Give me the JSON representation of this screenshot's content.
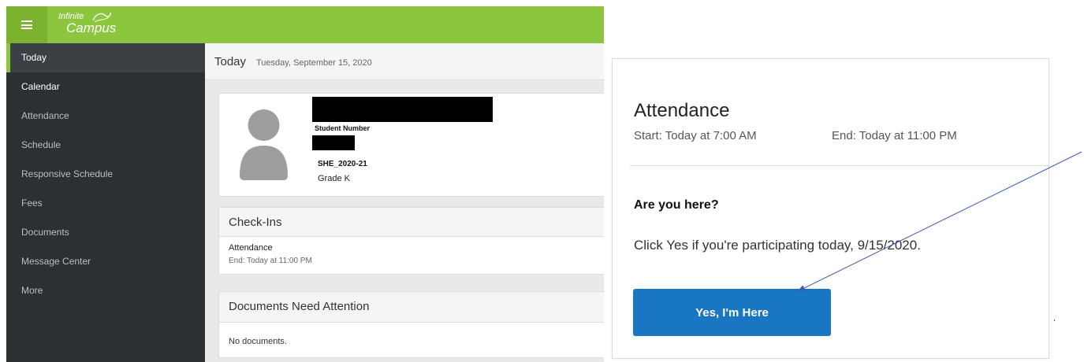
{
  "app": {
    "logo_line1": "Infinite",
    "logo_line2": "Campus",
    "brand_color": "#8cc63f"
  },
  "sidebar": {
    "items": [
      {
        "label": "Today"
      },
      {
        "label": "Calendar"
      },
      {
        "label": "Attendance"
      },
      {
        "label": "Schedule"
      },
      {
        "label": "Responsive Schedule"
      },
      {
        "label": "Fees"
      },
      {
        "label": "Documents"
      },
      {
        "label": "Message Center"
      },
      {
        "label": "More"
      }
    ]
  },
  "today": {
    "title": "Today",
    "date": "Tuesday, September 15, 2020"
  },
  "profile": {
    "student_number_label": "Student Number",
    "school": "SHE_2020-21",
    "grade": "Grade K"
  },
  "checkins": {
    "heading": "Check-Ins",
    "item_title": "Attendance",
    "item_sub": "End: Today at 11:00 PM"
  },
  "documents": {
    "heading": "Documents Need Attention",
    "empty": "No documents."
  },
  "panel": {
    "title": "Attendance",
    "start": "Start: Today at 7:00 AM",
    "end": "End: Today at 11:00 PM",
    "question": "Are you here?",
    "instruction": "Click Yes if you're participating today, 9/15/2020.",
    "button": "Yes, I'm Here",
    "button_color": "#1976c2"
  },
  "annotation": {
    "arrow_color": "#3b5bb5"
  }
}
